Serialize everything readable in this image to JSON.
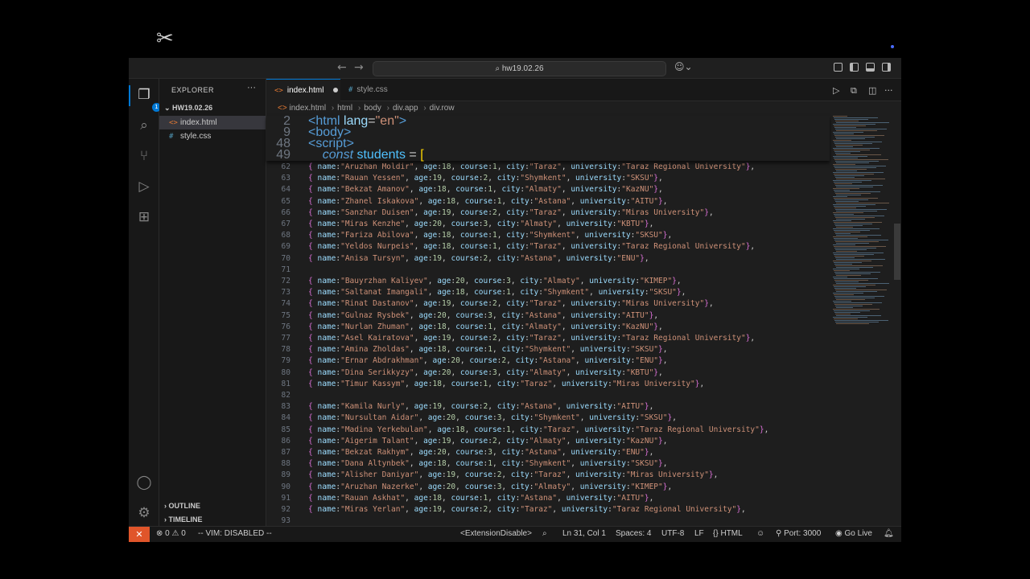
{
  "titlebar": {
    "search_text": "hw19.02.26",
    "back_arrow": "←",
    "forward_arrow": "→"
  },
  "activity_bar": {
    "explorer_badge": "1"
  },
  "sidebar": {
    "title": "EXPLORER",
    "more": "···",
    "folder": "HW19.02.26",
    "files": [
      {
        "icon": "<>",
        "name": "index.html"
      },
      {
        "icon": "#",
        "name": "style.css"
      }
    ],
    "outline": "OUTLINE",
    "timeline": "TIMELINE"
  },
  "tabs": [
    {
      "icon": "<>",
      "label": "index.html"
    },
    {
      "icon": "#",
      "label": "style.css"
    }
  ],
  "breadcrumbs": [
    "index.html",
    "html",
    "body",
    "div.app",
    "div.row"
  ],
  "sticky_lines": [
    {
      "n": "2",
      "parts": [
        [
          "tag",
          "<html"
        ],
        [
          "attr",
          " lang"
        ],
        [
          "punct",
          "="
        ],
        [
          "str",
          "\"en\""
        ],
        [
          "tag",
          ">"
        ]
      ]
    },
    {
      "n": "9",
      "parts": [
        [
          "tag",
          "<body>"
        ]
      ]
    },
    {
      "n": "48",
      "parts": [
        [
          "tag",
          "<script>"
        ]
      ]
    },
    {
      "n": "49",
      "parts": [
        [
          "punct",
          "    "
        ],
        [
          "kw",
          "const"
        ],
        [
          "punct",
          " "
        ],
        [
          "var",
          "students"
        ],
        [
          "punct",
          " = "
        ],
        [
          "bracket",
          "["
        ]
      ]
    }
  ],
  "code_lines": [
    {
      "n": "62",
      "t": "{ name:\"Aruzhan Moldir\", age:18, course:1, city:\"Taraz\", university:\"Taraz Regional University\"},"
    },
    {
      "n": "63",
      "t": "{ name:\"Rauan Yessen\", age:19, course:2, city:\"Shymkent\", university:\"SKSU\"},"
    },
    {
      "n": "64",
      "t": "{ name:\"Bekzat Amanov\", age:18, course:1, city:\"Almaty\", university:\"KazNU\"},"
    },
    {
      "n": "65",
      "t": "{ name:\"Zhanel Iskakova\", age:18, course:1, city:\"Astana\", university:\"AITU\"},"
    },
    {
      "n": "66",
      "t": "{ name:\"Sanzhar Duisen\", age:19, course:2, city:\"Taraz\", university:\"Miras University\"},"
    },
    {
      "n": "67",
      "t": "{ name:\"Miras Kenzhe\", age:20, course:3, city:\"Almaty\", university:\"KBTU\"},"
    },
    {
      "n": "68",
      "t": "{ name:\"Fariza Abilova\", age:18, course:1, city:\"Shymkent\", university:\"SKSU\"},"
    },
    {
      "n": "69",
      "t": "{ name:\"Yeldos Nurpeis\", age:18, course:1, city:\"Taraz\", university:\"Taraz Regional University\"},"
    },
    {
      "n": "70",
      "t": "{ name:\"Anisa Tursyn\", age:19, course:2, city:\"Astana\", university:\"ENU\"},"
    },
    {
      "n": "71",
      "t": ""
    },
    {
      "n": "72",
      "t": "{ name:\"Bauyrzhan Kaliyev\", age:20, course:3, city:\"Almaty\", university:\"KIMEP\"},"
    },
    {
      "n": "73",
      "t": "{ name:\"Saltanat Imangali\", age:18, course:1, city:\"Shymkent\", university:\"SKSU\"},"
    },
    {
      "n": "74",
      "t": "{ name:\"Rinat Dastanov\", age:19, course:2, city:\"Taraz\", university:\"Miras University\"},"
    },
    {
      "n": "75",
      "t": "{ name:\"Gulnaz Rysbek\", age:20, course:3, city:\"Astana\", university:\"AITU\"},"
    },
    {
      "n": "76",
      "t": "{ name:\"Nurlan Zhuman\", age:18, course:1, city:\"Almaty\", university:\"KazNU\"},"
    },
    {
      "n": "77",
      "t": "{ name:\"Asel Kairatova\", age:19, course:2, city:\"Taraz\", university:\"Taraz Regional University\"},"
    },
    {
      "n": "78",
      "t": "{ name:\"Amina Zholdas\", age:18, course:1, city:\"Shymkent\", university:\"SKSU\"},"
    },
    {
      "n": "79",
      "t": "{ name:\"Ernar Abdrakhman\", age:20, course:2, city:\"Astana\", university:\"ENU\"},"
    },
    {
      "n": "80",
      "t": "{ name:\"Dina Serikkyzy\", age:20, course:3, city:\"Almaty\", university:\"KBTU\"},"
    },
    {
      "n": "81",
      "t": "{ name:\"Timur Kassym\", age:18, course:1, city:\"Taraz\", university:\"Miras University\"},"
    },
    {
      "n": "82",
      "t": ""
    },
    {
      "n": "83",
      "t": "{ name:\"Kamila Nurly\", age:19, course:2, city:\"Astana\", university:\"AITU\"},"
    },
    {
      "n": "84",
      "t": "{ name:\"Nursultan Aidar\", age:20, course:3, city:\"Shymkent\", university:\"SKSU\"},"
    },
    {
      "n": "85",
      "t": "{ name:\"Madina Yerkebulan\", age:18, course:1, city:\"Taraz\", university:\"Taraz Regional University\"},"
    },
    {
      "n": "86",
      "t": "{ name:\"Aigerim Talant\", age:19, course:2, city:\"Almaty\", university:\"KazNU\"},"
    },
    {
      "n": "87",
      "t": "{ name:\"Bekzat Rakhym\", age:20, course:3, city:\"Astana\", university:\"ENU\"},"
    },
    {
      "n": "88",
      "t": "{ name:\"Dana Altynbek\", age:18, course:1, city:\"Shymkent\", university:\"SKSU\"},"
    },
    {
      "n": "89",
      "t": "{ name:\"Alisher Daniyar\", age:19, course:2, city:\"Taraz\", university:\"Miras University\"},"
    },
    {
      "n": "90",
      "t": "{ name:\"Aruzhan Nazerke\", age:20, course:3, city:\"Almaty\", university:\"KIMEP\"},"
    },
    {
      "n": "91",
      "t": "{ name:\"Rauan Askhat\", age:18, course:1, city:\"Astana\", university:\"AITU\"},"
    },
    {
      "n": "92",
      "t": "{ name:\"Miras Yerlan\", age:19, course:2, city:\"Taraz\", university:\"Taraz Regional University\"},"
    },
    {
      "n": "93",
      "t": ""
    }
  ],
  "statusbar": {
    "problems": "⊗ 0 ⚠ 0",
    "vim": "-- VIM: DISABLED --",
    "extension": "<ExtensionDisable>",
    "cursor": "Ln 31, Col 1",
    "spaces": "Spaces: 4",
    "encoding": "UTF-8",
    "eol": "LF",
    "language": "HTML",
    "port": "Port: 3000",
    "golive": "Go Live"
  },
  "colors": {
    "accent": "#0078d4",
    "remote": "#e0552a",
    "string": "#ce9178",
    "key": "#9cdcfe"
  }
}
